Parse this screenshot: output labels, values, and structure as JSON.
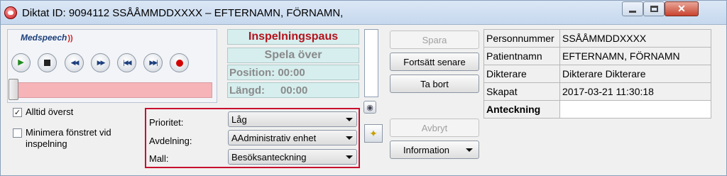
{
  "window": {
    "title": "Diktat ID: 9094112  SSÅÅMMDDXXXX – EFTERNAMN, FÖRNAMN,",
    "minimize_icon": "minimize-icon",
    "maximize_icon": "maximize-icon",
    "close_icon": "close-icon",
    "close_glyph": "✕"
  },
  "player": {
    "logo": "Medspeech",
    "logo_mark": "))",
    "controls": [
      {
        "name": "play-icon",
        "glyph": "▶"
      },
      {
        "name": "stop-icon",
        "glyph": ""
      },
      {
        "name": "rewind-icon",
        "glyph": "◀◀"
      },
      {
        "name": "fast-forward-icon",
        "glyph": "▶▶"
      },
      {
        "name": "skip-to-start-icon",
        "glyph": "|◀◀"
      },
      {
        "name": "skip-to-end-icon",
        "glyph": "▶▶|"
      },
      {
        "name": "record-icon",
        "glyph": ""
      }
    ],
    "slider_position": 0
  },
  "status": {
    "recording_pause": "Inspelningspaus",
    "play_over": "Spela över",
    "position": "Position: 00:00",
    "length_label": "Längd:",
    "length_value": "00:00"
  },
  "options": {
    "always_on_top": "Alltid överst",
    "always_on_top_checked": true,
    "check_glyph": "✓",
    "minimize_on_record": "Minimera fönstret vid inspelning",
    "minimize_on_record_checked": false
  },
  "fields": {
    "priority_label": "Prioritet:",
    "priority_value": "Låg",
    "department_label": "Avdelning:",
    "department_value": "AAdministrativ enhet",
    "template_label": "Mall:",
    "template_value": "Besöksanteckning"
  },
  "buttons": {
    "save": "Spara",
    "continue_later": "Fortsätt senare",
    "delete": "Ta bort",
    "cancel": "Avbryt",
    "information": "Information"
  },
  "tools": {
    "record_settings_icon": "record-settings-icon",
    "magic_wand_icon": "magic-wand-icon",
    "wand_glyph": "✦"
  },
  "patient_info": [
    {
      "label": "Personnummer",
      "value": "SSÅÅMMDDXXXX"
    },
    {
      "label": "Patientnamn",
      "value": "EFTERNAMN, FÖRNAMN"
    },
    {
      "label": "Dikterare",
      "value": "Dikterare Dikterare"
    },
    {
      "label": "Skapat",
      "value": "2017-03-21 11:30:18"
    },
    {
      "label": "Anteckning",
      "value": ""
    }
  ],
  "colors": {
    "pause_text": "#b5121b",
    "status_bg": "#d6eeee",
    "slider_track": "#f6b4b8",
    "fields_border": "#c8102e"
  }
}
